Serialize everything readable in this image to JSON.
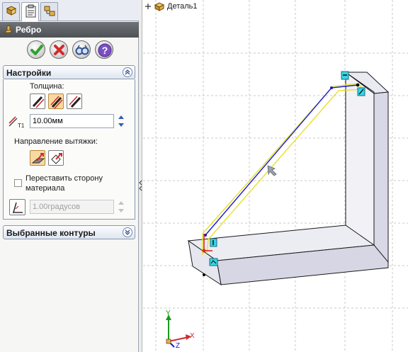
{
  "tabs": [
    {
      "name": "feature-manager",
      "icon": "feature-tree-icon",
      "active": false
    },
    {
      "name": "property-manager",
      "icon": "property-sheet-icon",
      "active": true
    },
    {
      "name": "configuration-manager",
      "icon": "configuration-icon",
      "active": false
    }
  ],
  "feature": {
    "title": "Ребро",
    "icon": "rib-icon"
  },
  "actions": [
    {
      "name": "ok-button",
      "icon": "checkmark-icon",
      "color": "#2ea12e"
    },
    {
      "name": "cancel-button",
      "icon": "close-icon",
      "color": "#d02b2b"
    },
    {
      "name": "preview-button",
      "icon": "glasses-icon",
      "color": "#2f4f8f"
    },
    {
      "name": "help-button",
      "icon": "help-icon",
      "color": "#6a3fb0"
    }
  ],
  "settings": {
    "header": "Настройки",
    "thickness_label": "Толщина:",
    "thickness_options": [
      "first-side",
      "both-sides",
      "second-side"
    ],
    "thickness_selected": "both-sides",
    "thickness_value": "10.00мм",
    "extrusion_label": "Направление вытяжки:",
    "extrusion_options": [
      "parallel-to-sketch",
      "normal-to-sketch"
    ],
    "extrusion_selected": "parallel-to-sketch",
    "flip_label_line1": "Переставить сторону",
    "flip_label_line2": "материала",
    "flip_checked": false,
    "draft_value": "1.00градусов"
  },
  "selected_contours": {
    "header": "Выбранные контуры"
  },
  "tree": {
    "part_name": "Деталь1"
  },
  "axes": {
    "x": "X",
    "y": "Y",
    "z": "Z"
  },
  "colors": {
    "accent_header": "#5a5f64",
    "sketch_line": "#1a1ad6",
    "preview_outline": "#e8e02a",
    "part_face": "#d8d8e6"
  }
}
